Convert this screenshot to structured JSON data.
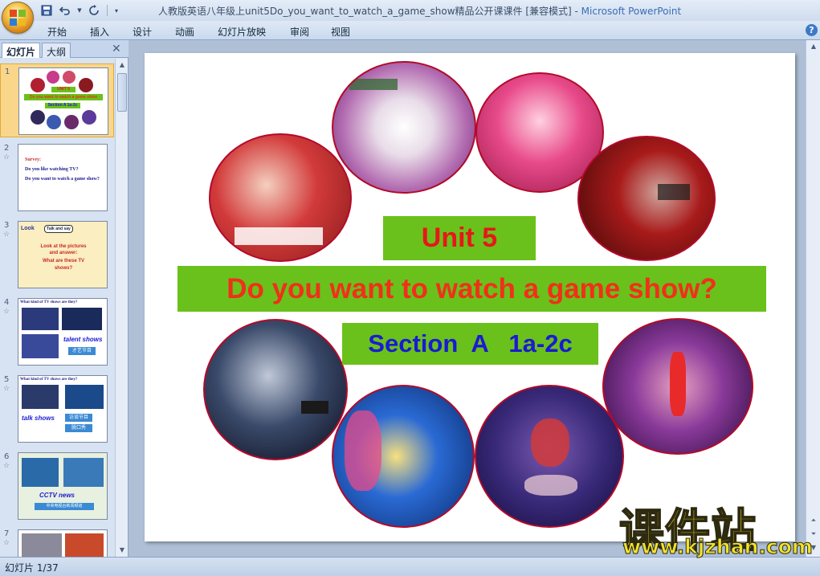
{
  "window": {
    "title_doc": "人教版英语八年级上unit5Do_you_want_to_watch_a_game_show精品公开课课件 [兼容模式] - ",
    "title_app": "Microsoft PowerPoint"
  },
  "quick_access": [
    "save-icon",
    "undo-icon",
    "redo-icon",
    "customize-icon"
  ],
  "ribbon": {
    "tabs": [
      "开始",
      "插入",
      "设计",
      "动画",
      "幻灯片放映",
      "审阅",
      "视图"
    ],
    "help": "?"
  },
  "pane": {
    "tab_slides": "幻灯片",
    "tab_outline": "大纲",
    "close": "✕",
    "slides": [
      {
        "num": "1",
        "mini_unit": "UNIT 5",
        "mini_q": "Do you want to watch a game show",
        "mini_sec": "Section A 1a-2c"
      },
      {
        "num": "2",
        "lines": [
          "Survey:",
          "Do you like watching TV?",
          "Do you want to watch a game show?"
        ]
      },
      {
        "num": "3",
        "tag1": "Look",
        "tag2": "Talk and say",
        "lines": [
          "Look at the pictures",
          "and answer:",
          "What are these TV",
          "shows?"
        ]
      },
      {
        "num": "4",
        "head": "What kind of TV shows are they?",
        "label": "talent shows",
        "cn": "才艺节目"
      },
      {
        "num": "5",
        "head": "What kind of TV shows are they?",
        "label": "talk shows",
        "cn1": "访谈节目",
        "cn2": "脱口秀"
      },
      {
        "num": "6",
        "label": "CCTV news",
        "cn": "中央电视台新闻频道"
      },
      {
        "num": "7"
      }
    ]
  },
  "slide": {
    "unit": "Unit 5",
    "question": "Do you want to watch a game show?",
    "section": "Section  A   1a-2c"
  },
  "watermark": {
    "cn": "课件站",
    "url": "www.kjzhan.com"
  },
  "status": {
    "slide_counter": "幻灯片 1/37"
  },
  "colors": {
    "green_box": "#6ac11b",
    "unit_red": "#e8161a",
    "question_red": "#f0301a",
    "section_blue": "#1a1ad4",
    "selected_thumb": "#f9d68a"
  }
}
